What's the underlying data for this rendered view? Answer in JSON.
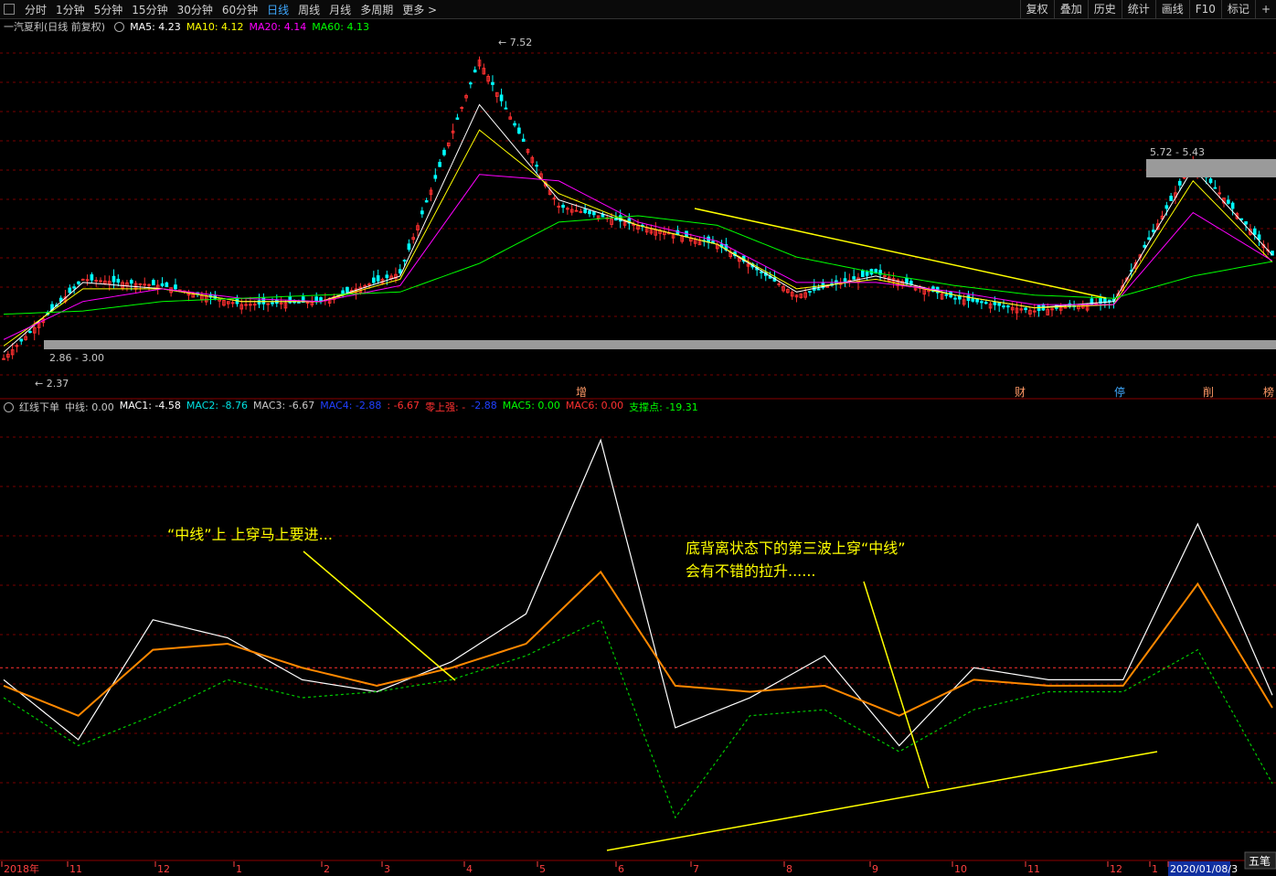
{
  "toolbar": {
    "periods": [
      "分时",
      "1分钟",
      "5分钟",
      "15分钟",
      "30分钟",
      "60分钟",
      "日线",
      "周线",
      "月线",
      "多周期",
      "更多"
    ],
    "active": "日线",
    "right_buttons": [
      "复权",
      "叠加",
      "历史",
      "统计",
      "画线",
      "F10",
      "标记",
      "+"
    ]
  },
  "top_legend": {
    "title": "一汽夏利(日线 前复权)",
    "items": [
      {
        "label": "MA5: 4.23",
        "color": "#ffffff"
      },
      {
        "label": "MA10: 4.12",
        "color": "#ffff00"
      },
      {
        "label": "MA20: 4.14",
        "color": "#ff00ff"
      },
      {
        "label": "MA60: 4.13",
        "color": "#00ff00"
      }
    ]
  },
  "bottom_legend": {
    "title": "红线下单",
    "items": [
      {
        "label": "中线: 0.00",
        "color": "#c8c8c8"
      },
      {
        "label": "MAC1: -4.58",
        "color": "#ffffff"
      },
      {
        "label": "MAC2: -8.76",
        "color": "#00e0e0"
      },
      {
        "label": "MAC3: -6.67",
        "color": "#c8c8c8"
      },
      {
        "label": "MAC4: -2.88",
        "color": "#2040ff"
      },
      {
        "label": ": -6.67",
        "color": "#ff3030"
      },
      {
        "label": "零上强: -",
        "color": "#ff3030"
      },
      {
        "label": "-2.88",
        "color": "#2040ff"
      },
      {
        "label": "MAC5: 0.00",
        "color": "#00ff00"
      },
      {
        "label": "MAC6: 0.00",
        "color": "#ff3030"
      },
      {
        "label": "支撑点: -19.31",
        "color": "#00ff00"
      }
    ]
  },
  "price_labels": {
    "high": "7.52",
    "low": "2.37",
    "band_low": "2.86 - 3.00",
    "band_high": "5.72 - 5.43"
  },
  "event_markers": [
    "增",
    "财",
    "停",
    "削",
    "榜"
  ],
  "x_axis": [
    "2018年",
    "11",
    "12",
    "1",
    "2",
    "3",
    "4",
    "5",
    "6",
    "7",
    "8",
    "9",
    "10",
    "11",
    "12",
    "1",
    "2020/01/08/3"
  ],
  "bottom_right_tag": "五笔",
  "annotations": [
    {
      "text": "“中线”上 上穿马上要进..."
    },
    {
      "text": "底背离状态下的第三波上穿“中线”"
    },
    {
      "text": "会有不错的拉升......"
    }
  ],
  "colors": {
    "ma5": "#ffffff",
    "ma10": "#ffff00",
    "ma20": "#ff00ff",
    "ma60": "#00ff00",
    "up": "#ff3030",
    "down": "#00ffff",
    "annotation": "#ffff00",
    "grid": "#7a0000"
  },
  "chart_data": [
    {
      "type": "line",
      "title": "一汽夏利(日线 前复权)",
      "ylim": [
        2.2,
        7.7
      ],
      "x": [
        "2018-10",
        "2018-11",
        "2018-12",
        "2019-01",
        "2019-02",
        "2019-03",
        "2019-04",
        "2019-05",
        "2019-06",
        "2019-07",
        "2019-08",
        "2019-09",
        "2019-10",
        "2019-11",
        "2019-12",
        "2020-01"
      ],
      "series": [
        {
          "name": "close",
          "values": [
            2.6,
            3.85,
            3.75,
            3.45,
            3.5,
            3.95,
            7.3,
            5.0,
            4.7,
            4.4,
            3.6,
            3.95,
            3.55,
            3.35,
            3.5,
            5.7,
            4.23
          ]
        },
        {
          "name": "MA5",
          "values": [
            2.7,
            3.8,
            3.7,
            3.5,
            3.5,
            3.9,
            6.6,
            5.1,
            4.7,
            4.4,
            3.65,
            3.9,
            3.6,
            3.4,
            3.5,
            5.6,
            4.23
          ]
        },
        {
          "name": "MA10",
          "values": [
            2.8,
            3.7,
            3.7,
            3.5,
            3.5,
            3.85,
            6.2,
            5.2,
            4.7,
            4.4,
            3.7,
            3.85,
            3.6,
            3.4,
            3.45,
            5.4,
            4.12
          ]
        },
        {
          "name": "MA20",
          "values": [
            2.9,
            3.5,
            3.7,
            3.55,
            3.5,
            3.75,
            5.5,
            5.4,
            4.75,
            4.45,
            3.8,
            3.8,
            3.65,
            3.45,
            3.45,
            4.9,
            4.14
          ]
        },
        {
          "name": "MA60",
          "values": [
            3.3,
            3.35,
            3.5,
            3.55,
            3.6,
            3.65,
            4.1,
            4.75,
            4.85,
            4.7,
            4.2,
            3.95,
            3.75,
            3.6,
            3.55,
            3.9,
            4.13
          ]
        }
      ]
    },
    {
      "type": "line",
      "title": "红线下单",
      "ylim": [
        -32,
        42
      ],
      "x": [
        "2018-10",
        "2018-11",
        "2018-12",
        "2019-01",
        "2019-02",
        "2019-03",
        "2019-04",
        "2019-05",
        "2019-06",
        "2019-07",
        "2019-08",
        "2019-09",
        "2019-10",
        "2019-11",
        "2019-12",
        "2020-01"
      ],
      "series": [
        {
          "name": "MAC1",
          "values": [
            -2,
            -12,
            8,
            5,
            -2,
            -4,
            1,
            9,
            38,
            -10,
            -5,
            2,
            -13,
            0,
            -2,
            -2,
            24,
            -4.58
          ]
        },
        {
          "name": "MAC3",
          "values": [
            -3,
            -8,
            3,
            4,
            0,
            -3,
            0,
            4,
            16,
            -3,
            -4,
            -3,
            -8,
            -2,
            -3,
            -3,
            14,
            -6.67
          ]
        },
        {
          "name": "支撑点",
          "values": [
            -5,
            -13,
            -8,
            -2,
            -5,
            -4,
            -2,
            2,
            8,
            -25,
            -8,
            -7,
            -14,
            -7,
            -4,
            -4,
            3,
            -19.31
          ]
        }
      ]
    }
  ]
}
